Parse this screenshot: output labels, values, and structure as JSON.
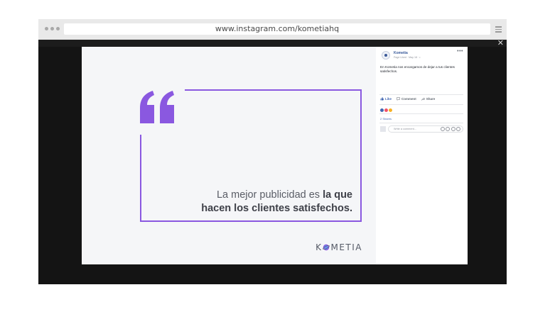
{
  "browser": {
    "url": "www.instagram.com/kometiahq"
  },
  "viewer": {
    "close_label": "✕"
  },
  "photo": {
    "quote_line1_normal": "La mejor publicidad es ",
    "quote_line1_bold": "la que",
    "quote_line2": "hacen los clientes satisfechos.",
    "brand_left": "K",
    "brand_right": "METIA",
    "colors": {
      "accent": "#8a58e0",
      "background": "#f5f6f8",
      "text": "#3e4048"
    }
  },
  "facebook_panel": {
    "page_name": "Kometia",
    "meta": "Page Liked · May 18 · ",
    "more": "•••",
    "post_text": "En Kometia nos encargamos de dejar a tus clientes satisfechos.",
    "actions": {
      "like": "Like",
      "comment": "Comment",
      "share": "Share"
    },
    "shares": "2 Shares",
    "comment_placeholder": "Write a comment...",
    "colors": {
      "link": "#4267b2",
      "name": "#365899"
    }
  }
}
